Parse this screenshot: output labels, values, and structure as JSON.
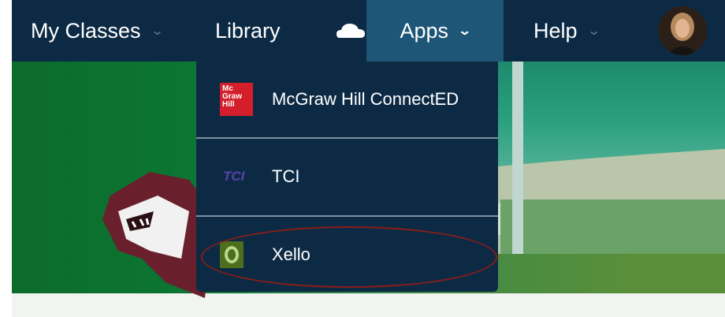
{
  "nav": {
    "my_classes": "My Classes",
    "library": "Library",
    "apps": "Apps",
    "help": "Help",
    "cloud_icon": "cloud-icon",
    "avatar": "user-avatar"
  },
  "apps_menu": {
    "items": [
      {
        "label": "McGraw Hill ConnectED",
        "logo_text": "Mc Graw Hill",
        "icon": "mcgraw-hill-logo"
      },
      {
        "label": "TCI",
        "logo_text": "TCI",
        "icon": "tci-logo"
      },
      {
        "label": "Xello",
        "icon": "xello-logo"
      }
    ]
  },
  "colors": {
    "navbar": "#0d2a45",
    "apps_active": "#1d5676",
    "mcgraw_red": "#d41e2b",
    "tci_purple": "#5744a8",
    "xello_green": "#4c6e1d",
    "annotation": "#8b1d17"
  }
}
